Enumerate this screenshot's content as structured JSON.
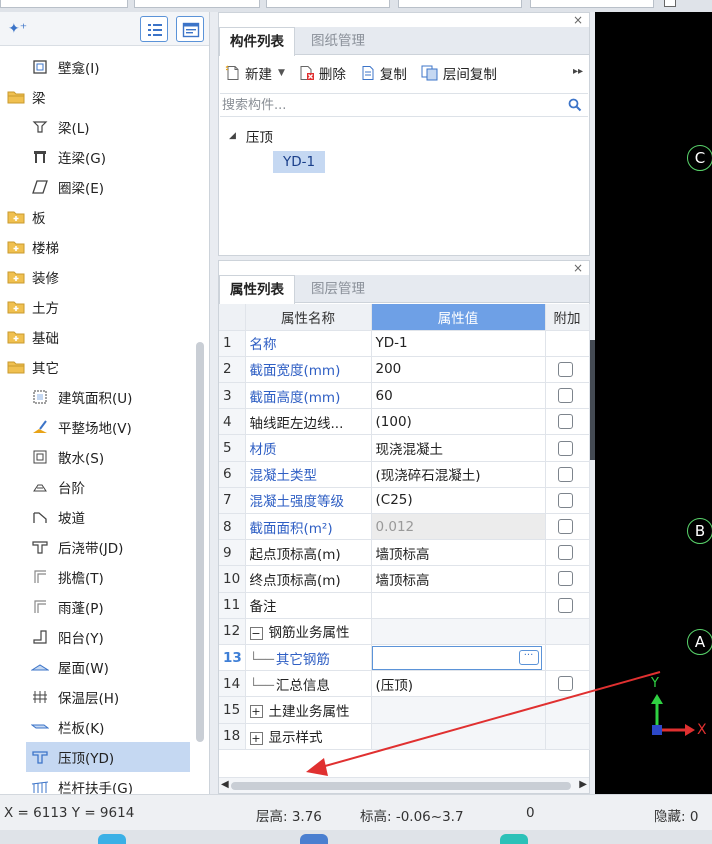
{
  "left_tree": [
    {
      "label": "壁龛(I)",
      "level": 1,
      "icon": "niche-icon"
    },
    {
      "label": "梁",
      "level": 0,
      "icon": "folder-open-icon"
    },
    {
      "label": "梁(L)",
      "level": 1,
      "icon": "beam-icon"
    },
    {
      "label": "连梁(G)",
      "level": 1,
      "icon": "coupling-beam-icon"
    },
    {
      "label": "圈梁(E)",
      "level": 1,
      "icon": "ring-beam-icon"
    },
    {
      "label": "板",
      "level": 0,
      "icon": "folder-plus-icon"
    },
    {
      "label": "楼梯",
      "level": 0,
      "icon": "folder-plus-icon"
    },
    {
      "label": "装修",
      "level": 0,
      "icon": "folder-plus-icon"
    },
    {
      "label": "土方",
      "level": 0,
      "icon": "folder-plus-icon"
    },
    {
      "label": "基础",
      "level": 0,
      "icon": "folder-plus-icon"
    },
    {
      "label": "其它",
      "level": 0,
      "icon": "folder-open-icon"
    },
    {
      "label": "建筑面积(U)",
      "level": 1,
      "icon": "building-area-icon"
    },
    {
      "label": "平整场地(V)",
      "level": 1,
      "icon": "site-leveling-icon"
    },
    {
      "label": "散水(S)",
      "level": 1,
      "icon": "apron-icon"
    },
    {
      "label": "台阶",
      "level": 1,
      "icon": "steps-icon"
    },
    {
      "label": "坡道",
      "level": 1,
      "icon": "ramp-icon"
    },
    {
      "label": "后浇带(JD)",
      "level": 1,
      "icon": "post-pour-strip-icon"
    },
    {
      "label": "挑檐(T)",
      "level": 1,
      "icon": "eave-icon"
    },
    {
      "label": "雨蓬(P)",
      "level": 1,
      "icon": "canopy-icon"
    },
    {
      "label": "阳台(Y)",
      "level": 1,
      "icon": "balcony-icon"
    },
    {
      "label": "屋面(W)",
      "level": 1,
      "icon": "roof-icon"
    },
    {
      "label": "保温层(H)",
      "level": 1,
      "icon": "insulation-icon"
    },
    {
      "label": "栏板(K)",
      "level": 1,
      "icon": "parapet-board-icon"
    },
    {
      "label": "压顶(YD)",
      "level": 1,
      "icon": "coping-icon",
      "selected": true
    },
    {
      "label": "栏杆扶手(G)",
      "level": 1,
      "icon": "railing-icon"
    }
  ],
  "comp_panel": {
    "tab_active": "构件列表",
    "tab_inactive": "图纸管理",
    "toolbar": {
      "new_label": "新建",
      "delete_label": "删除",
      "copy_label": "复制",
      "floor_copy_label": "层间复制"
    },
    "search_placeholder": "搜索构件...",
    "tree_root": "压顶",
    "tree_leaf": "YD-1"
  },
  "prop_panel": {
    "tab_active": "属性列表",
    "tab_inactive": "图层管理",
    "col_name": "属性名称",
    "col_value": "属性值",
    "col_extra": "附加",
    "rows": [
      {
        "num": "1",
        "name": "名称",
        "value": "YD-1",
        "blue": true,
        "check": false
      },
      {
        "num": "2",
        "name": "截面宽度(mm)",
        "value": "200",
        "blue": true,
        "check": true
      },
      {
        "num": "3",
        "name": "截面高度(mm)",
        "value": "60",
        "blue": true,
        "check": true
      },
      {
        "num": "4",
        "name": "轴线距左边线...",
        "value": "(100)",
        "blue": false,
        "check": true
      },
      {
        "num": "5",
        "name": "材质",
        "value": "现浇混凝土",
        "blue": true,
        "check": true
      },
      {
        "num": "6",
        "name": "混凝土类型",
        "value": "(现浇碎石混凝土)",
        "blue": true,
        "check": true
      },
      {
        "num": "7",
        "name": "混凝土强度等级",
        "value": "(C25)",
        "blue": true,
        "check": true
      },
      {
        "num": "8",
        "name": "截面面积(m²)",
        "value": "0.012",
        "blue": true,
        "check": true,
        "disabled": true
      },
      {
        "num": "9",
        "name": "起点顶标高(m)",
        "value": "墙顶标高",
        "blue": false,
        "check": true
      },
      {
        "num": "10",
        "name": "终点顶标高(m)",
        "value": "墙顶标高",
        "blue": false,
        "check": true
      },
      {
        "num": "11",
        "name": "备注",
        "value": "",
        "blue": false,
        "check": true
      },
      {
        "num": "12",
        "name": "钢筋业务属性",
        "value": "",
        "group": "minus"
      },
      {
        "num": "13",
        "name": "其它钢筋",
        "value": "",
        "sub": true,
        "current": true,
        "blue": true
      },
      {
        "num": "14",
        "name": "汇总信息",
        "value": "(压顶)",
        "sub": true,
        "check": true
      },
      {
        "num": "15",
        "name": "土建业务属性",
        "value": "",
        "group": "plus"
      },
      {
        "num": "18",
        "name": "显示样式",
        "value": "",
        "group": "plus"
      }
    ]
  },
  "canvas_axes": [
    {
      "label": "C"
    },
    {
      "label": "B"
    },
    {
      "label": "A"
    }
  ],
  "axis_x_label": "X",
  "axis_y_label": "Y",
  "status": {
    "coords": "X = 6113 Y = 9614",
    "floor_height": "层高:  3.76",
    "elevation": "标高: -0.06~3.7",
    "zero": "0",
    "hidden": "隐藏:  0"
  },
  "colors": {
    "accent_blue": "#3c74c8",
    "selected_bg": "#c5d8f2",
    "header_blue": "#6ea0e6",
    "annotation_red": "#e03030",
    "axis_green": "#59d36b"
  }
}
